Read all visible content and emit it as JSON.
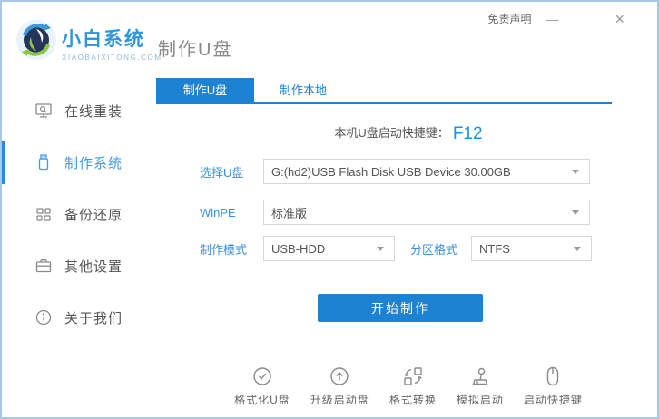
{
  "window": {
    "disclaimer": "免责声明",
    "minimize_label": "—",
    "close_label": "×"
  },
  "header": {
    "brand_name": "小白系统",
    "brand_domain": "XIAOBAIXITONG.COM",
    "page_title": "制作U盘",
    "logo_icon": "sync-globe-logo"
  },
  "sidebar": {
    "items": [
      {
        "label": "在线重装",
        "icon": "monitor-reinstall-icon",
        "active": false
      },
      {
        "label": "制作系统",
        "icon": "usb-drive-icon",
        "active": true
      },
      {
        "label": "备份还原",
        "icon": "backup-restore-icon",
        "active": false
      },
      {
        "label": "其他设置",
        "icon": "briefcase-settings-icon",
        "active": false
      },
      {
        "label": "关于我们",
        "icon": "info-circle-icon",
        "active": false
      }
    ]
  },
  "main": {
    "tabs": [
      {
        "label": "制作U盘",
        "active": true
      },
      {
        "label": "制作本地",
        "active": false
      }
    ],
    "hotkey_label": "本机U盘启动快捷键：",
    "hotkey_value": "F12",
    "form": {
      "usb_select": {
        "label": "选择U盘",
        "value": "G:(hd2)USB Flash Disk USB Device 30.00GB"
      },
      "winpe": {
        "label": "WinPE",
        "value": "标准版"
      },
      "mode": {
        "label": "制作模式",
        "value": "USB-HDD"
      },
      "partition": {
        "label": "分区格式",
        "value": "NTFS"
      }
    },
    "start_button": "开始制作",
    "footer_tools": [
      {
        "label": "格式化U盘",
        "icon": "format-usb-icon"
      },
      {
        "label": "升级启动盘",
        "icon": "upgrade-boot-icon"
      },
      {
        "label": "格式转换",
        "icon": "format-convert-icon"
      },
      {
        "label": "模拟启动",
        "icon": "simulate-boot-icon"
      },
      {
        "label": "启动快捷键",
        "icon": "boot-hotkey-icon"
      }
    ]
  },
  "colors": {
    "primary_blue": "#1E82D2",
    "label_blue": "#3B90DF",
    "active_text_blue": "#3E97E8",
    "window_border": "#A9C8E8",
    "logo_green": "#8CC63F",
    "logo_blue": "#3A9AD9"
  }
}
